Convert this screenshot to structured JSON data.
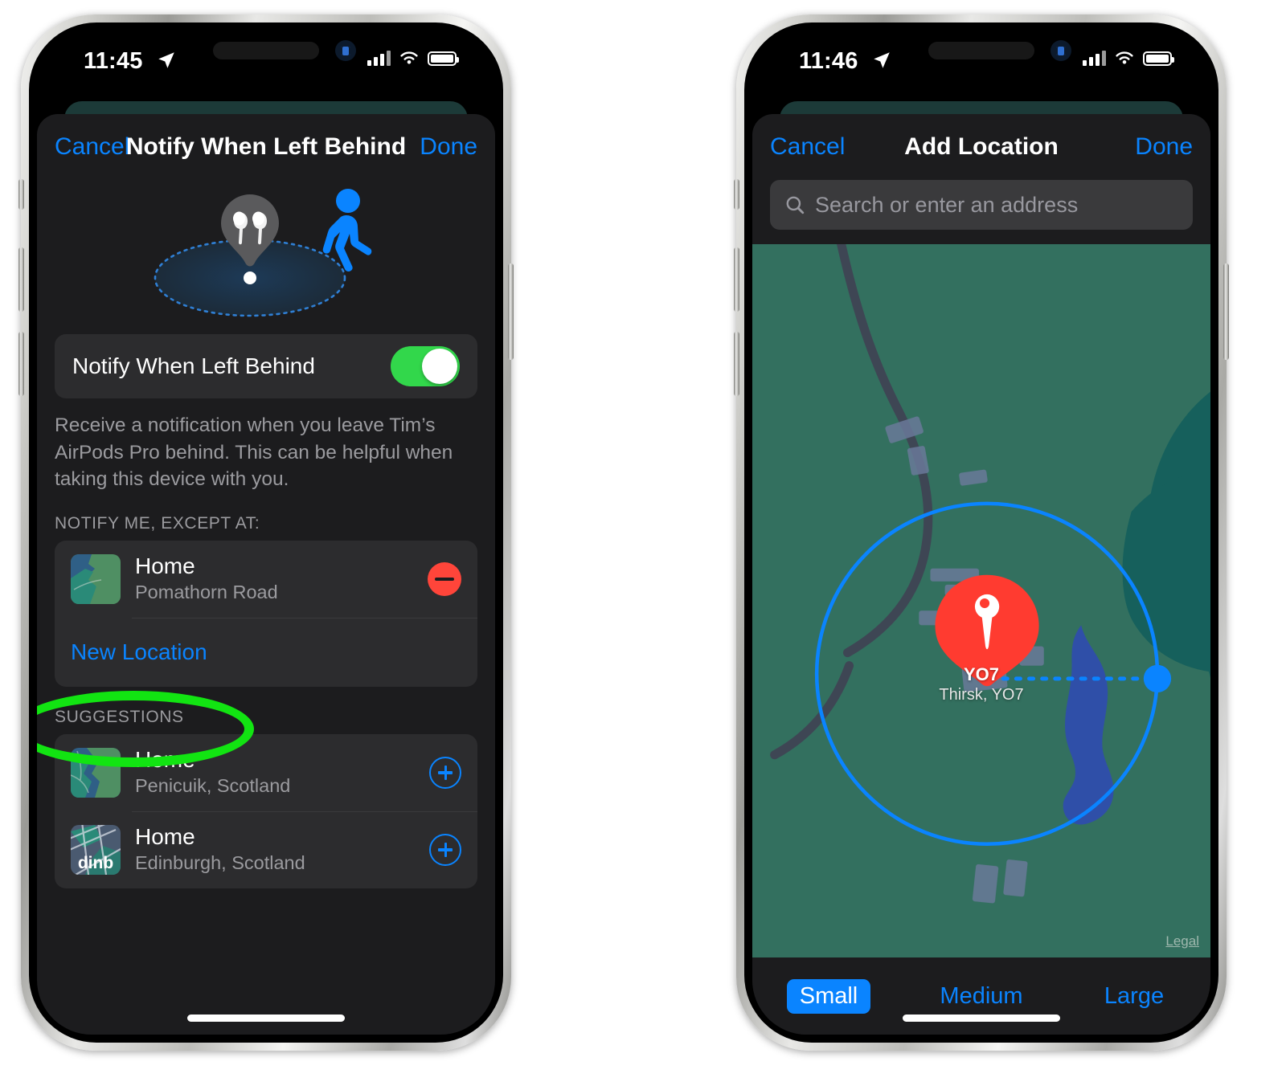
{
  "phones": [
    {
      "id": "left",
      "status_bar": {
        "time": "11:45",
        "location_icon": "location-arrow-icon",
        "signal_icon": "cellular-bars-icon",
        "wifi_icon": "wifi-icon",
        "battery_icon": "battery-icon"
      },
      "nav": {
        "cancel": "Cancel",
        "title": "Notify When Left Behind",
        "done": "Done"
      },
      "hero": {
        "device_icon": "airpods-pro-icon",
        "person_icon": "walking-person-icon",
        "geofence_icon": "dashed-ellipse-icon"
      },
      "toggle_row": {
        "label": "Notify When Left Behind",
        "state": "on",
        "on_color": "#32d74b"
      },
      "footnote": "Receive a notification when you leave Tim’s AirPods Pro behind. This can be helpful when taking this device with you.",
      "except_header": "NOTIFY ME, EXCEPT AT:",
      "except_items": [
        {
          "title": "Home",
          "subtitle": "Pomathorn Road",
          "action_icon": "remove-circle-icon",
          "thumb": "map-thumbnail"
        }
      ],
      "new_location_label": "New Location",
      "suggestions_header": "SUGGESTIONS",
      "suggestions": [
        {
          "title": "Home",
          "subtitle": "Penicuik, Scotland",
          "action_icon": "add-circle-icon",
          "thumb": "map-thumbnail"
        },
        {
          "title": "Home",
          "subtitle": "Edinburgh, Scotland",
          "action_icon": "add-circle-icon",
          "thumb": "map-thumbnail-dinb",
          "thumb_text": "dinb"
        }
      ],
      "annotation": {
        "shape": "ellipse-highlight",
        "color": "#12e412",
        "target": "New Location"
      }
    },
    {
      "id": "right",
      "status_bar": {
        "time": "11:46",
        "location_icon": "location-arrow-icon",
        "signal_icon": "cellular-bars-icon",
        "wifi_icon": "wifi-icon",
        "battery_icon": "battery-icon"
      },
      "nav": {
        "cancel": "Cancel",
        "title": "Add Location",
        "done": "Done"
      },
      "search": {
        "placeholder": "Search or enter an address",
        "value": "",
        "icon": "search-icon"
      },
      "map": {
        "pin_icon": "red-map-pin-icon",
        "pin_title": "YO7",
        "pin_subtitle": "Thirsk, YO7",
        "radius_handle_icon": "radius-handle-icon",
        "geofence_color": "#0a84ff",
        "land_color": "#33705f",
        "water_color": "#16605c",
        "legal_label": "Legal"
      },
      "segments": [
        {
          "label": "Small",
          "selected": true
        },
        {
          "label": "Medium",
          "selected": false
        },
        {
          "label": "Large",
          "selected": false
        }
      ]
    }
  ]
}
